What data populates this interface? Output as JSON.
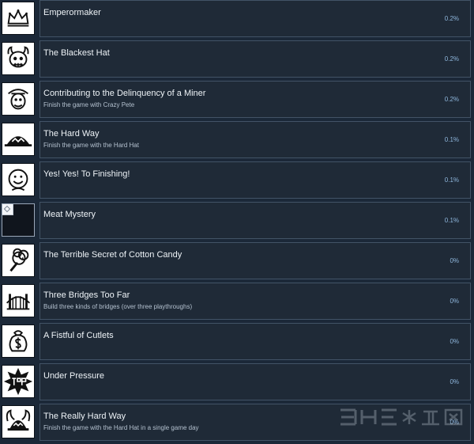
{
  "colors": {
    "background": "#1b2838",
    "panel": "#1f2a37",
    "panel_border": "#425366",
    "title": "#eef3f7",
    "description": "#b4c1cf",
    "percent": "#8fb7dd"
  },
  "achievements": [
    {
      "title": "Emperormaker",
      "description": "",
      "percent": "0.2%",
      "icon": "crown-icon"
    },
    {
      "title": "The Blackest Hat",
      "description": "",
      "percent": "0.2%",
      "icon": "viking-skull-icon"
    },
    {
      "title": "Contributing to the Delinquency of a Miner",
      "description": "Finish the game with Crazy Pete",
      "percent": "0.2%",
      "icon": "crazy-pete-icon"
    },
    {
      "title": "The Hard Way",
      "description": "Finish the game with the Hard Hat",
      "percent": "0.1%",
      "icon": "hard-hat-icon"
    },
    {
      "title": "Yes! Yes! To Finishing!",
      "description": "",
      "percent": "0.1%",
      "icon": "smiley-icon"
    },
    {
      "title": "Meat Mystery",
      "description": "",
      "percent": "0.1%",
      "icon": "broken-image-icon"
    },
    {
      "title": "The Terrible Secret of Cotton Candy",
      "description": "",
      "percent": "0%",
      "icon": "cotton-candy-icon"
    },
    {
      "title": "Three Bridges Too Far",
      "description": "Build three kinds of bridges (over three playthroughs)",
      "percent": "0%",
      "icon": "bridge-icon"
    },
    {
      "title": "A Fistful of Cutlets",
      "description": "",
      "percent": "0%",
      "icon": "money-bag-icon"
    },
    {
      "title": "Under Pressure",
      "description": "",
      "percent": "0%",
      "icon": "pop-burst-icon"
    },
    {
      "title": "The Really Hard Way",
      "description": "Finish the game with the Hard Hat in a single game day",
      "percent": "0%",
      "icon": "viking-helmet-icon"
    }
  ]
}
